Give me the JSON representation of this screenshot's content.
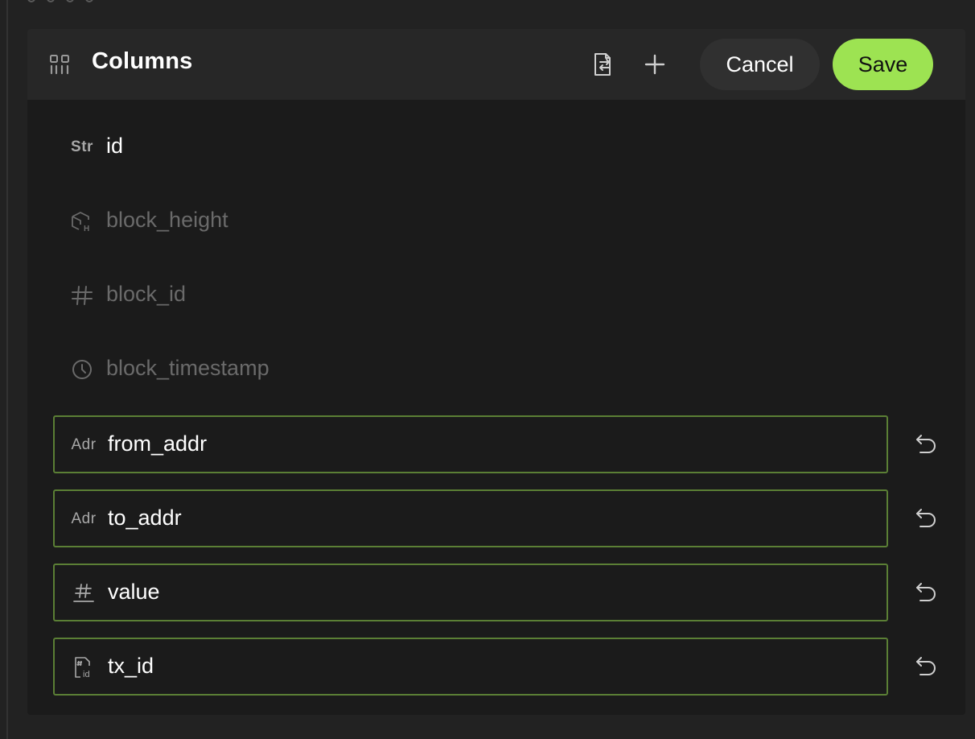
{
  "panel": {
    "title": "Columns",
    "icons": {
      "title": "columns-icon",
      "import": "file-import-icon",
      "add": "plus-icon"
    },
    "buttons": {
      "cancel": "Cancel",
      "save": "Save"
    }
  },
  "colors": {
    "accent": "#9de352",
    "editing_border": "#5b7f35",
    "muted_text": "#6a6a6a"
  },
  "columns": [
    {
      "type_label": "Str",
      "name": "id",
      "state": "normal",
      "icon": "string-type-icon"
    },
    {
      "type_label": "",
      "name": "block_height",
      "state": "disabled",
      "icon": "block-height-icon"
    },
    {
      "type_label": "",
      "name": "block_id",
      "state": "disabled",
      "icon": "hash-icon"
    },
    {
      "type_label": "",
      "name": "block_timestamp",
      "state": "disabled",
      "icon": "clock-icon"
    },
    {
      "type_label": "Adr",
      "name": "from_addr",
      "state": "editing",
      "icon": "address-type-icon",
      "action_icon": "undo-icon"
    },
    {
      "type_label": "Adr",
      "name": "to_addr",
      "state": "editing",
      "icon": "address-type-icon",
      "action_icon": "undo-icon"
    },
    {
      "type_label": "",
      "name": "value",
      "state": "editing",
      "icon": "number-type-icon",
      "action_icon": "undo-icon"
    },
    {
      "type_label": "",
      "name": "tx_id",
      "state": "editing",
      "icon": "tx-id-icon",
      "action_icon": "undo-icon"
    }
  ]
}
